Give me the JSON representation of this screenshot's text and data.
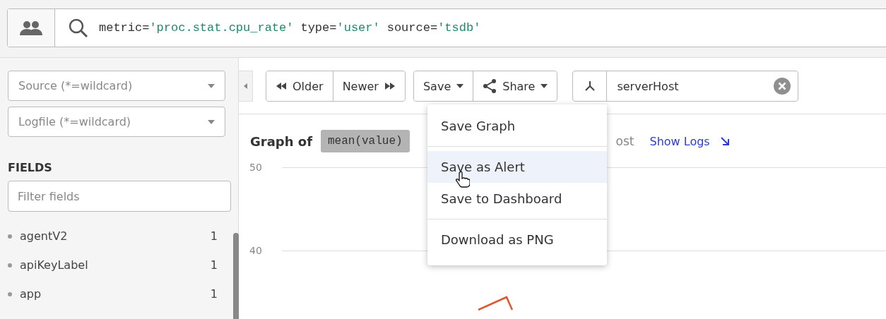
{
  "query": {
    "terms": [
      {
        "key": "metric=",
        "value": "'proc.stat.cpu_rate'"
      },
      {
        "key": "type=",
        "value": "'user'"
      },
      {
        "key": "source=",
        "value": "'tsdb'"
      }
    ]
  },
  "sidebar": {
    "source_placeholder": "Source (*=wildcard)",
    "logfile_placeholder": "Logfile (*=wildcard)",
    "fields_heading": "FIELDS",
    "filter_placeholder": "Filter fields",
    "fields": [
      {
        "name": "agentV2",
        "count": "1"
      },
      {
        "name": "apiKeyLabel",
        "count": "1"
      },
      {
        "name": "app",
        "count": "1"
      }
    ]
  },
  "toolbar": {
    "older": "Older",
    "newer": "Newer",
    "save": "Save",
    "share": "Share",
    "group_by": "serverHost"
  },
  "graph": {
    "title": "Graph of",
    "aggregate": "mean(value)",
    "title_tail": "ost",
    "show_logs": "Show Logs",
    "axis_labels": [
      "50",
      "40"
    ]
  },
  "save_menu": {
    "groups": [
      [
        {
          "label": "Save Graph",
          "highlighted": false
        }
      ],
      [
        {
          "label": "Save as Alert",
          "highlighted": true
        },
        {
          "label": "Save to Dashboard",
          "highlighted": false
        }
      ],
      [
        {
          "label": "Download as PNG",
          "highlighted": false
        }
      ]
    ]
  }
}
